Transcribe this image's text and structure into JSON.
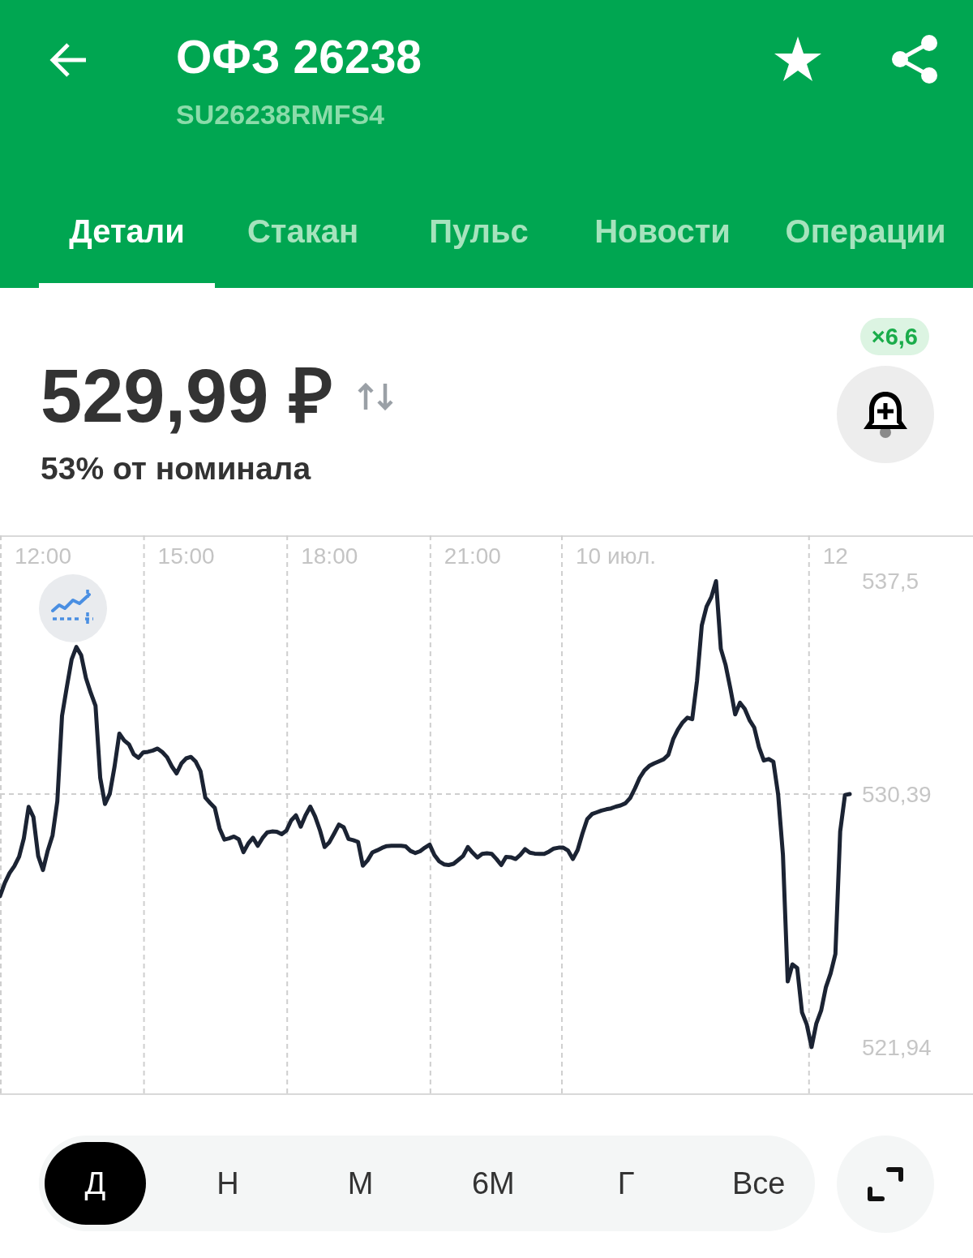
{
  "header": {
    "title": "ОФЗ 26238",
    "subtitle": "SU26238RMFS4"
  },
  "tabs": [
    {
      "label": "Детали",
      "selected": true
    },
    {
      "label": "Стакан",
      "selected": false
    },
    {
      "label": "Пульс",
      "selected": false
    },
    {
      "label": "Новости",
      "selected": false
    },
    {
      "label": "Операции",
      "selected": false
    }
  ],
  "quote": {
    "price": "529,99 ₽",
    "nominal_share": "53% от номинала",
    "badge": "×6,6"
  },
  "chart": {
    "chart_data": {
      "type": "line",
      "categories": [
        null,
        null,
        null,
        null,
        null,
        null,
        null,
        null,
        null,
        "12:00",
        null,
        null,
        null,
        null,
        null,
        null,
        null,
        null,
        null,
        null,
        null,
        null,
        null,
        null,
        null,
        null,
        null,
        null,
        null,
        null,
        null,
        null,
        null,
        null,
        null,
        null,
        null,
        null,
        null,
        "15:00",
        null,
        null,
        null,
        null,
        null,
        null,
        null,
        null,
        null,
        null,
        null,
        null,
        null,
        null,
        null,
        null,
        null,
        null,
        null,
        null,
        null,
        null,
        null,
        null,
        null,
        null,
        null,
        null,
        null,
        "18:00",
        null,
        null,
        null,
        null,
        null,
        null,
        null,
        null,
        null,
        null,
        null,
        null,
        null,
        null,
        null,
        null,
        null,
        null,
        null,
        null,
        null,
        null,
        null,
        null,
        null,
        null,
        null,
        null,
        null,
        "21:00",
        null,
        null,
        null,
        null,
        null,
        null,
        null,
        null,
        null,
        null,
        null,
        null,
        null,
        null,
        null,
        null,
        null,
        null,
        null,
        null,
        null,
        null,
        null,
        null,
        null,
        null,
        null,
        null,
        null,
        "10 июл.",
        null,
        null,
        null,
        null,
        null,
        null,
        null,
        null,
        null,
        null,
        null,
        null,
        null,
        null,
        null,
        null,
        null,
        null,
        null,
        null,
        null,
        null,
        null,
        null,
        null,
        null,
        null,
        null,
        null,
        null,
        null,
        null,
        null,
        null,
        null,
        null,
        null,
        null,
        null,
        null,
        null,
        null,
        null,
        null,
        null,
        "12",
        null,
        null,
        null
      ],
      "series": [
        {
          "color": "#1b2333",
          "values": [
            526.98,
            527.42,
            527.75,
            527.98,
            528.3,
            528.91,
            529.96,
            529.62,
            528.32,
            527.85,
            528.5,
            529.01,
            530.15,
            533.0,
            533.96,
            534.88,
            535.3,
            535.03,
            534.26,
            533.77,
            533.34,
            530.93,
            530.06,
            530.4,
            531.31,
            532.41,
            532.18,
            532.05,
            531.72,
            531.6,
            531.78,
            531.8,
            531.84,
            531.91,
            531.79,
            531.62,
            531.31,
            531.08,
            531.41,
            531.58,
            531.63,
            531.47,
            531.15,
            530.27,
            530.09,
            529.93,
            529.24,
            528.87,
            528.91,
            528.97,
            528.88,
            528.45,
            528.74,
            528.93,
            528.66,
            528.92,
            529.11,
            529.14,
            529.13,
            529.05,
            529.17,
            529.51,
            529.68,
            529.3,
            529.68,
            529.97,
            529.64,
            529.19,
            528.62,
            528.78,
            529.07,
            529.37,
            529.28,
            528.89,
            528.85,
            528.79,
            528.0,
            528.17,
            528.44,
            528.51,
            528.59,
            528.65,
            528.66,
            528.66,
            528.66,
            528.64,
            528.49,
            528.42,
            528.48,
            528.6,
            528.7,
            528.35,
            528.14,
            528.04,
            528.02,
            528.06,
            528.19,
            528.32,
            528.62,
            528.43,
            528.27,
            528.39,
            528.41,
            528.39,
            528.22,
            528.02,
            528.29,
            528.28,
            528.22,
            528.36,
            528.55,
            528.43,
            528.4,
            528.39,
            528.39,
            528.47,
            528.57,
            528.6,
            528.6,
            528.5,
            528.22,
            528.52,
            529.07,
            529.55,
            529.72,
            529.78,
            529.84,
            529.88,
            529.91,
            529.97,
            530.01,
            530.08,
            530.26,
            530.58,
            530.93,
            531.18,
            531.33,
            531.41,
            531.48,
            531.55,
            531.7,
            532.22,
            532.54,
            532.78,
            532.94,
            532.89,
            534.16,
            536.02,
            536.65,
            536.97,
            537.5,
            535.24,
            534.7,
            533.91,
            533.05,
            533.44,
            533.23,
            532.86,
            532.61,
            531.95,
            531.51,
            531.56,
            531.47,
            530.37,
            528.36,
            524.13,
            524.7,
            524.58,
            523.1,
            522.69,
            521.94,
            522.73,
            523.16,
            523.94,
            524.4,
            525.05,
            529.14,
            530.36,
            530.39
          ]
        }
      ],
      "ylim": [
        520.34,
        539.03
      ],
      "yticks": [
        {
          "value": 537.5,
          "label": "537,5"
        },
        {
          "value": 530.39,
          "label": "530,39"
        },
        {
          "value": 521.94,
          "label": "521,94"
        }
      ]
    }
  },
  "periods": [
    {
      "label": "Д",
      "selected": true
    },
    {
      "label": "Н",
      "selected": false
    },
    {
      "label": "М",
      "selected": false
    },
    {
      "label": "6М",
      "selected": false
    },
    {
      "label": "Г",
      "selected": false
    },
    {
      "label": "Все",
      "selected": false
    }
  ]
}
